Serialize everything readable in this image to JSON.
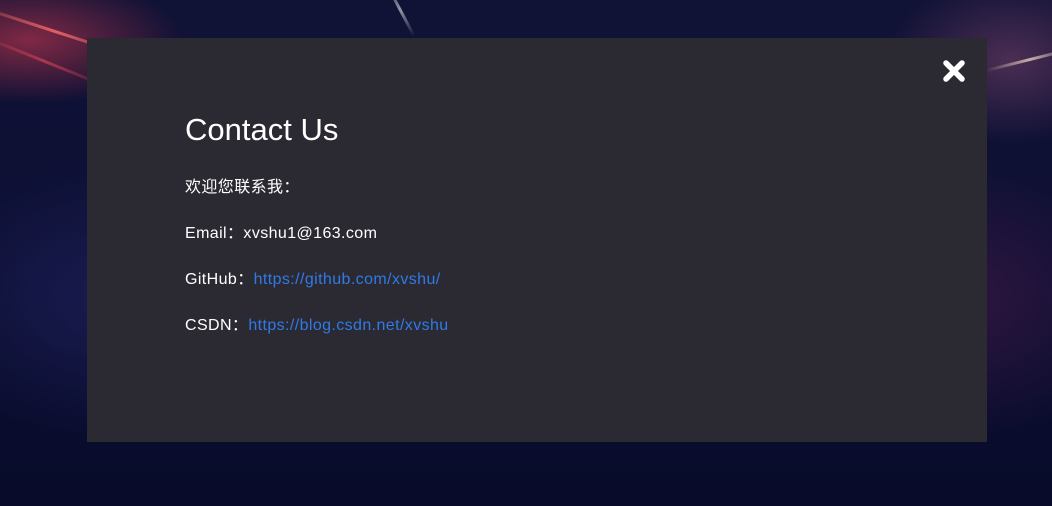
{
  "modal": {
    "title": "Contact Us",
    "intro": "欢迎您联系我：",
    "email": {
      "label": "Email：",
      "value": "xvshu1@163.com"
    },
    "github": {
      "label": "GitHub：",
      "link": "https://github.com/xvshu/"
    },
    "csdn": {
      "label": "CSDN：",
      "link": "https://blog.csdn.net/xvshu"
    },
    "close_icon": "close-icon"
  },
  "colors": {
    "modal_background": "#2b2a33",
    "text": "#ffffff",
    "link": "#2f7ae6"
  }
}
